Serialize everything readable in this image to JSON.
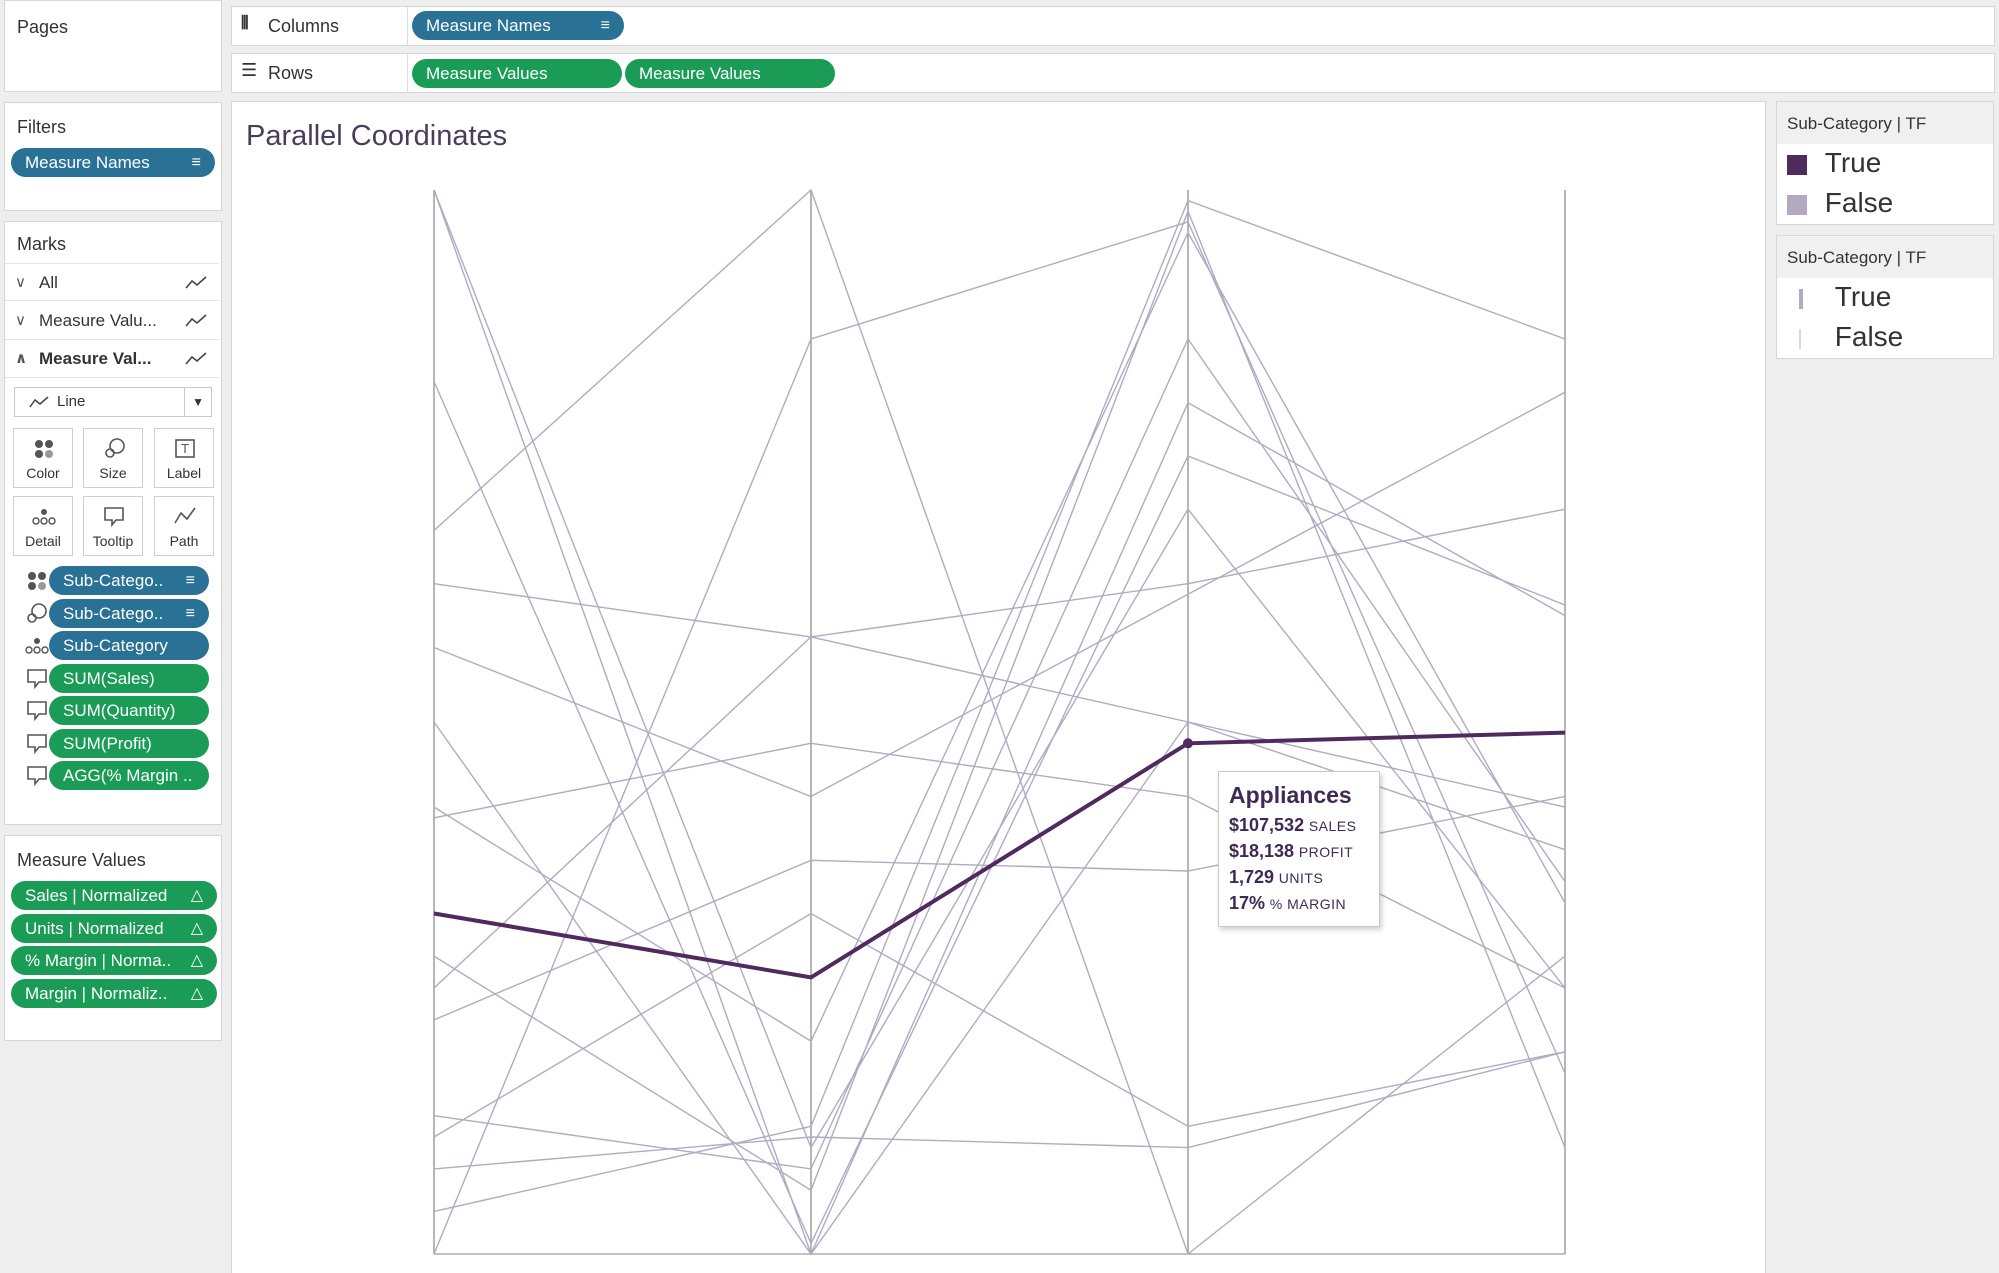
{
  "pages": {
    "title": "Pages"
  },
  "columns": {
    "label": "Columns",
    "pills": [
      "Measure Names"
    ]
  },
  "rows": {
    "label": "Rows",
    "pills": [
      "Measure Values",
      "Measure Values"
    ]
  },
  "filters": {
    "title": "Filters",
    "pills": [
      "Measure Names"
    ]
  },
  "marks": {
    "title": "Marks",
    "cards": [
      "All",
      "Measure Valu...",
      "Measure Val..."
    ],
    "mark_type": "Line",
    "buttons": [
      "Color",
      "Size",
      "Label",
      "Detail",
      "Tooltip",
      "Path"
    ],
    "fields": [
      {
        "label": "Sub-Catego..",
        "color": "blue",
        "icon": "color-dots-icon",
        "sort": true
      },
      {
        "label": "Sub-Catego..",
        "color": "blue",
        "icon": "size-icon",
        "sort": true
      },
      {
        "label": "Sub-Category",
        "color": "blue",
        "icon": "detail-icon",
        "sort": false
      },
      {
        "label": "SUM(Sales)",
        "color": "green",
        "icon": "tooltip-icon",
        "sort": false
      },
      {
        "label": "SUM(Quantity)",
        "color": "green",
        "icon": "tooltip-icon",
        "sort": false
      },
      {
        "label": "SUM(Profit)",
        "color": "green",
        "icon": "tooltip-icon",
        "sort": false
      },
      {
        "label": "AGG(% Margin ..",
        "color": "green",
        "icon": "tooltip-icon",
        "sort": false
      }
    ]
  },
  "measure_values": {
    "title": "Measure Values",
    "pills": [
      "Sales | Normalized",
      "Units | Normalized",
      "% Margin | Norma..",
      "Margin | Normaliz.."
    ]
  },
  "legends": [
    {
      "title": "Sub-Category | TF",
      "items": [
        {
          "label": "True",
          "color": "#4e2a5e"
        },
        {
          "label": "False",
          "color": "#b3a9c2"
        }
      ]
    },
    {
      "title": "Sub-Category | TF",
      "items": [
        {
          "label": "True",
          "color": "#b3a9c2"
        },
        {
          "label": "False",
          "color": "#dcd7e3"
        }
      ]
    }
  ],
  "colors": {
    "highlight": "#4e2a5e",
    "base": "#b3a9c2",
    "axis": "#9e9e9e",
    "blue_pill": "#2a7196",
    "green_pill": "#1a9c57"
  },
  "tooltip": {
    "title": "Appliances",
    "rows": [
      {
        "value": "$107,532",
        "unit": "SALES"
      },
      {
        "value": "$18,138",
        "unit": "PROFIT"
      },
      {
        "value": "1,729",
        "unit": "UNITS"
      },
      {
        "value": "17%",
        "unit": "% MARGIN"
      }
    ]
  },
  "chart_data": {
    "type": "line",
    "title": "Parallel Coordinates",
    "categories": [
      "Sales | Normalized",
      "Units | Normalized",
      "% Margin | Normalized",
      "Margin | Normalized"
    ],
    "ylim": [
      0,
      1
    ],
    "grid": false,
    "legend": "right",
    "highlighted": "Appliances",
    "series": [
      {
        "name": "Appliances",
        "values": [
          0.32,
          0.26,
          0.48,
          0.49
        ],
        "highlight": true
      },
      {
        "values": [
          1.0,
          0.0,
          0.8,
          0.6
        ]
      },
      {
        "values": [
          1.0,
          0.1,
          0.7,
          0.25
        ]
      },
      {
        "values": [
          0.68,
          1.0,
          0.0,
          0.28
        ]
      },
      {
        "values": [
          0.63,
          0.58,
          0.5,
          0.38
        ]
      },
      {
        "values": [
          0.5,
          0.0,
          0.5,
          0.42
        ]
      },
      {
        "values": [
          0.0,
          0.86,
          0.97,
          0.17
        ]
      },
      {
        "values": [
          0.04,
          0.12,
          0.99,
          0.86
        ]
      },
      {
        "values": [
          0.41,
          0.48,
          0.43,
          0.25
        ]
      },
      {
        "values": [
          0.25,
          0.58,
          0.63,
          0.7
        ]
      },
      {
        "values": [
          0.22,
          0.37,
          0.36,
          0.43
        ]
      },
      {
        "values": [
          0.11,
          0.32,
          0.12,
          0.19
        ]
      },
      {
        "values": [
          0.08,
          0.11,
          0.1,
          0.19
        ]
      },
      {
        "values": [
          0.28,
          0.06,
          0.98,
          0.1
        ]
      },
      {
        "values": [
          0.57,
          0.43,
          0.62,
          0.81
        ]
      },
      {
        "values": [
          0.82,
          0.01,
          0.75,
          0.61
        ]
      },
      {
        "values": [
          0.42,
          0.2,
          0.96,
          0.33
        ]
      },
      {
        "values": [
          0.13,
          0.08,
          0.86,
          0.35
        ]
      }
    ]
  }
}
